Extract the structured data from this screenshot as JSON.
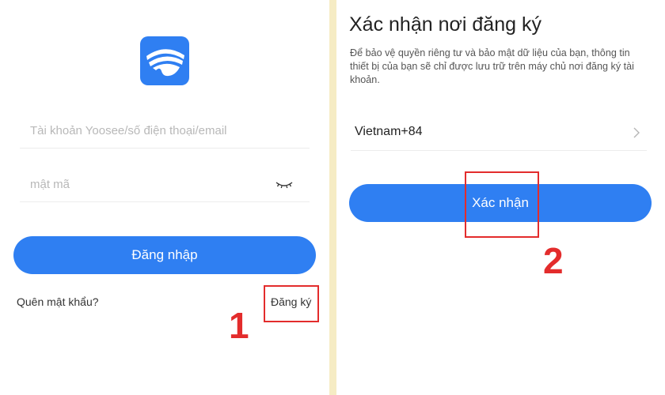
{
  "login_screen": {
    "account_placeholder": "Tài khoản Yoosee/số điện thoại/email",
    "password_placeholder": "mật mã",
    "login_button": "Đăng nhập",
    "forgot_password": "Quên mật khẩu?",
    "register_link": "Đăng ký",
    "step_number": "1",
    "logo_icon": "yoosee-eye-logo-icon",
    "password_toggle_icon": "closed-eye-icon"
  },
  "region_screen": {
    "title": "Xác nhận nơi đăng ký",
    "description": "Để bảo vệ quyền riêng tư và bảo mật dữ liệu của bạn, thông tin thiết bị của bạn sẽ chỉ được lưu trữ trên máy chủ nơi đăng ký tài khoản.",
    "region_value": "Vietnam+84",
    "region_chevron_icon": "chevron-right-icon",
    "confirm_button": "Xác nhận",
    "step_number": "2"
  },
  "colors": {
    "primary": "#2f7ff2",
    "highlight": "#e32c2c",
    "divider_background": "#f6ecc4"
  }
}
